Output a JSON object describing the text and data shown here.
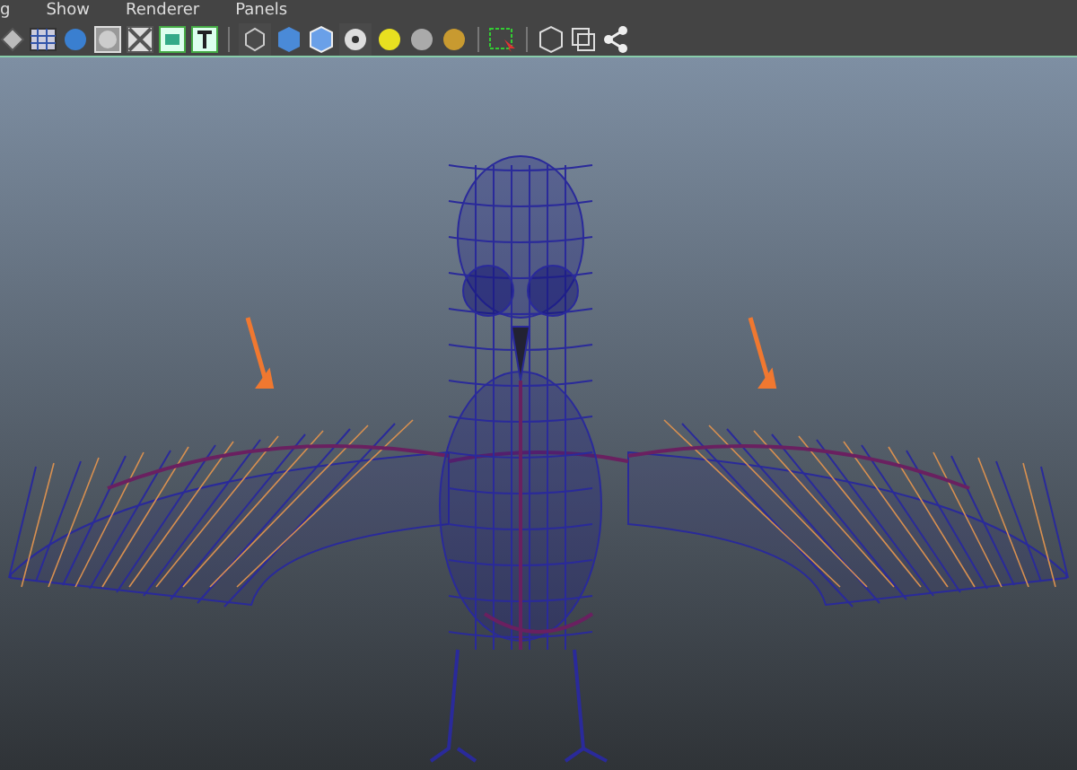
{
  "menu_bar": {
    "items": [
      "g",
      "Show",
      "Renderer",
      "Panels"
    ]
  }
}
